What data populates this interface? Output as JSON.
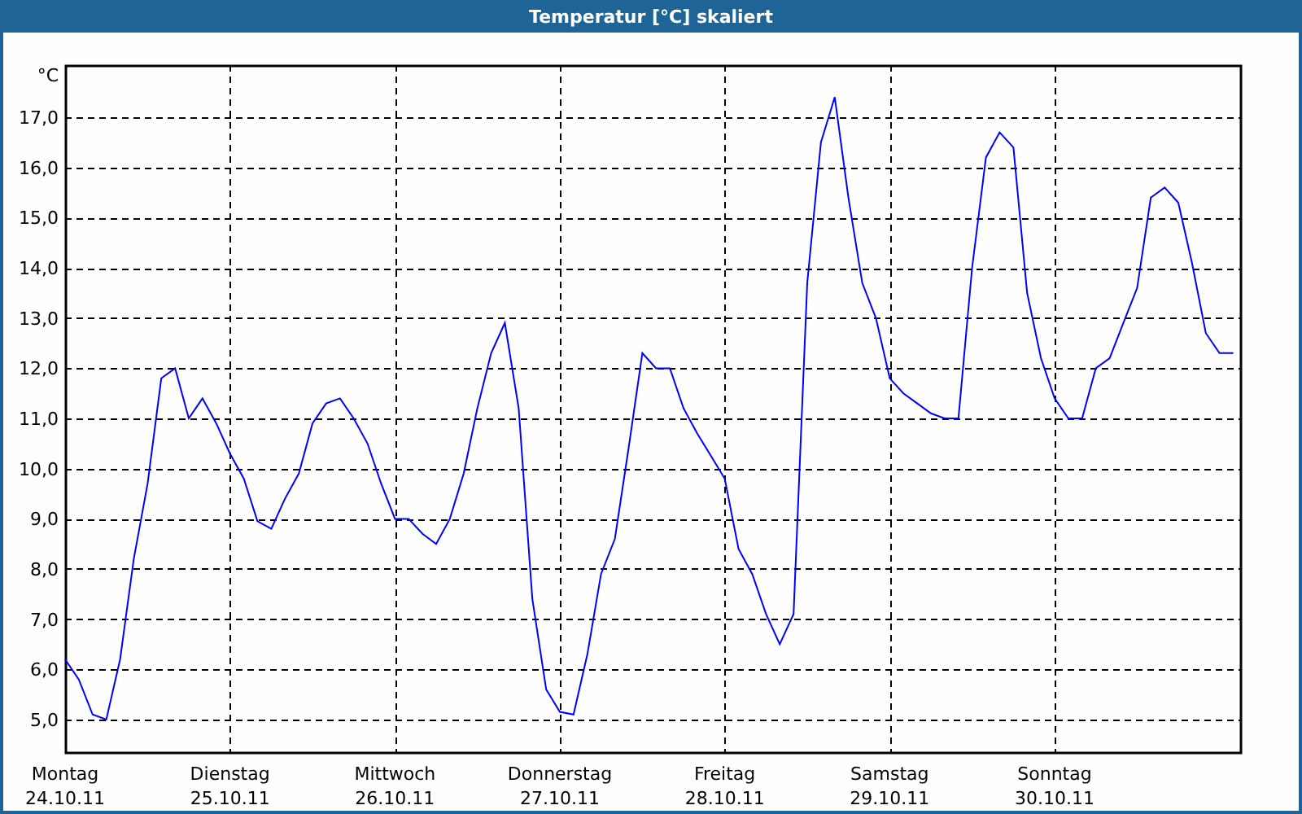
{
  "window": {
    "title": "Temperatur [°C] skaliert"
  },
  "chart_data": {
    "type": "line",
    "ylabel": "°C",
    "grid": true,
    "ylim": [
      4.35,
      18.04
    ],
    "categories": [
      "Montag\n24.10.11",
      null,
      null,
      null,
      null,
      null,
      null,
      null,
      null,
      null,
      null,
      null,
      "Dienstag\n25.10.11",
      null,
      null,
      null,
      null,
      null,
      null,
      null,
      null,
      null,
      null,
      null,
      "Mittwoch\n26.10.11",
      null,
      null,
      null,
      null,
      null,
      null,
      null,
      null,
      null,
      null,
      null,
      "Donnerstag\n27.10.11",
      null,
      null,
      null,
      null,
      null,
      null,
      null,
      null,
      null,
      null,
      null,
      "Freitag\n28.10.11",
      null,
      null,
      null,
      null,
      null,
      null,
      null,
      null,
      null,
      null,
      null,
      "Samstag\n29.10.11",
      null,
      null,
      null,
      null,
      null,
      null,
      null,
      null,
      null,
      null,
      null,
      "Sonntag\n30.10.11",
      null,
      null,
      null,
      null,
      null,
      null,
      null,
      null,
      null,
      null,
      null,
      null,
      null
    ],
    "yticks": [
      {
        "value": 5,
        "label": "5,0"
      },
      {
        "value": 6,
        "label": "6,0"
      },
      {
        "value": 7,
        "label": "7,0"
      },
      {
        "value": 8,
        "label": "8,0"
      },
      {
        "value": 9,
        "label": "9,0"
      },
      {
        "value": 10,
        "label": "10,0"
      },
      {
        "value": 11,
        "label": "11,0"
      },
      {
        "value": 12,
        "label": "12,0"
      },
      {
        "value": 13,
        "label": "13,0"
      },
      {
        "value": 14,
        "label": "14,0"
      },
      {
        "value": 15,
        "label": "15,0"
      },
      {
        "value": 16,
        "label": "16,0"
      },
      {
        "value": 17,
        "label": "17,0"
      }
    ],
    "series": [
      {
        "color": "#0000ff",
        "values": [
          6.2,
          5.8,
          5.1,
          5.0,
          6.2,
          8.2,
          9.7,
          11.8,
          12.0,
          11.0,
          11.4,
          10.9,
          10.3,
          9.8,
          8.95,
          8.8,
          9.4,
          9.9,
          10.9,
          11.3,
          11.4,
          11.0,
          10.5,
          9.7,
          9.0,
          9.0,
          8.7,
          8.5,
          9.0,
          9.9,
          11.2,
          12.3,
          12.9,
          11.2,
          7.4,
          5.6,
          5.15,
          5.1,
          6.3,
          7.9,
          8.6,
          10.4,
          12.3,
          12.0,
          12.0,
          11.2,
          10.7,
          10.25,
          9.8,
          8.4,
          7.9,
          7.1,
          6.5,
          7.1,
          13.7,
          16.5,
          17.4,
          15.4,
          13.7,
          13.0,
          11.8,
          11.5,
          11.3,
          11.1,
          11.0,
          11.0,
          14.0,
          16.2,
          16.7,
          16.4,
          13.5,
          12.2,
          11.4,
          11.0,
          11.0,
          12.0,
          12.2,
          12.9,
          13.6,
          15.4,
          15.6,
          15.3,
          14.1,
          12.7,
          12.3,
          12.3
        ]
      }
    ]
  }
}
